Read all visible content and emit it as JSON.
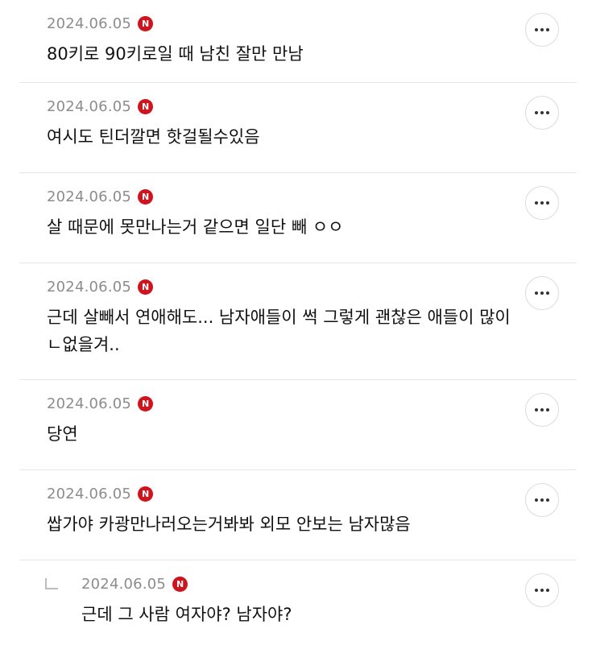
{
  "comments": [
    {
      "date": "2024.06.05",
      "badge": "N",
      "text": "80키로 90키로일 때 남친 잘만 만남"
    },
    {
      "date": "2024.06.05",
      "badge": "N",
      "text": "여시도 틴더깔면 핫걸될수있음"
    },
    {
      "date": "2024.06.05",
      "badge": "N",
      "text": "살 때문에 못만나는거 같으면 일단 빼 ㅇㅇ"
    },
    {
      "date": "2024.06.05",
      "badge": "N",
      "text": "근데 살빼서 연애해도... 남자애들이 썩 그렇게 괜찮은 애들이 많이 ㄴ없을겨.."
    },
    {
      "date": "2024.06.05",
      "badge": "N",
      "text": "당연"
    },
    {
      "date": "2024.06.05",
      "badge": "N",
      "text": "쌉가야 카광만나러오는거봐봐 외모 안보는 남자많음"
    }
  ],
  "reply": {
    "date": "2024.06.05",
    "badge": "N",
    "text": "근데 그 사람 여자야? 남자야?"
  },
  "colors": {
    "badge": "#d0141e",
    "date": "#8c8c8c",
    "divider": "#e6e6e6"
  }
}
